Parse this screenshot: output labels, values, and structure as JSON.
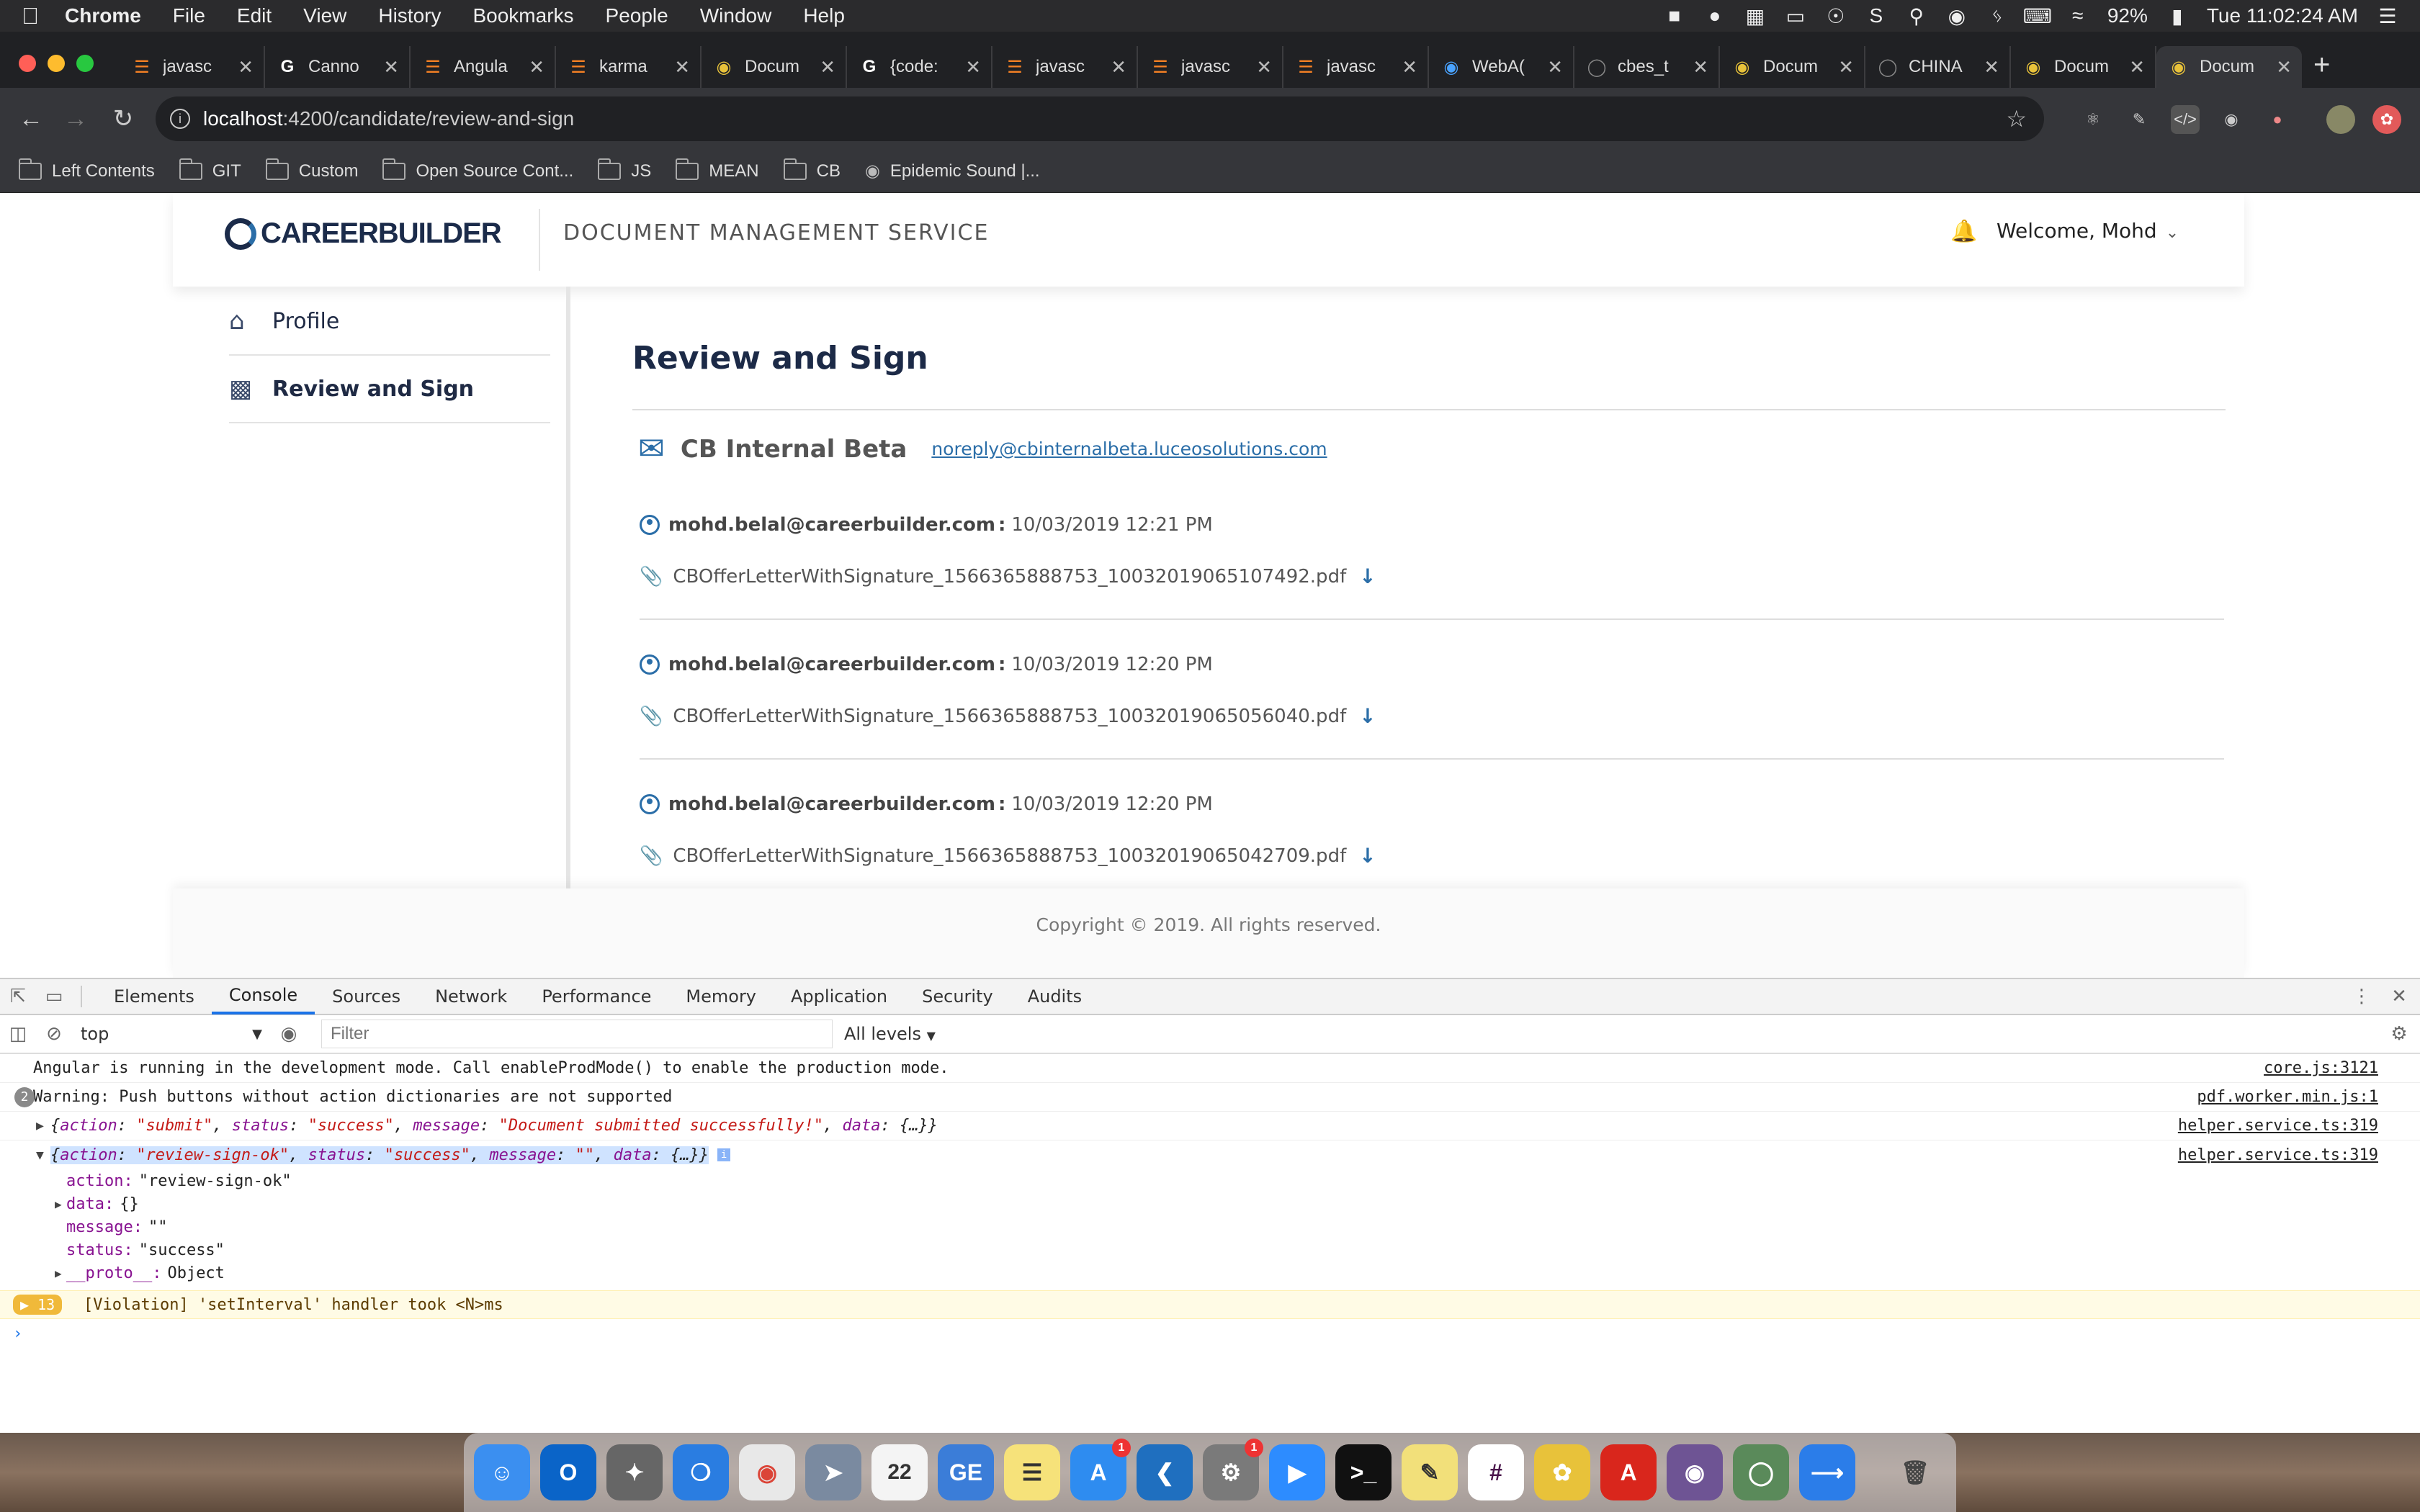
{
  "menubar": {
    "app": "Chrome",
    "items": [
      "File",
      "Edit",
      "View",
      "History",
      "Bookmarks",
      "People",
      "Window",
      "Help"
    ],
    "battery": "92%",
    "clock": "Tue 11:02:24 AM"
  },
  "tabs": [
    {
      "title": "javasc"
    },
    {
      "title": "Canno"
    },
    {
      "title": "Angula"
    },
    {
      "title": "karma"
    },
    {
      "title": "Docum"
    },
    {
      "title": "{code:"
    },
    {
      "title": "javasc"
    },
    {
      "title": "javasc"
    },
    {
      "title": "javasc"
    },
    {
      "title": "WebA("
    },
    {
      "title": "cbes_t"
    },
    {
      "title": "Docum"
    },
    {
      "title": "CHINA"
    },
    {
      "title": "Docum"
    },
    {
      "title": "Docum"
    }
  ],
  "address": {
    "host": "localhost",
    "path": ":4200/candidate/review-and-sign"
  },
  "bookmarks": [
    "Left Contents",
    "GIT",
    "Custom",
    "Open Source Cont...",
    "JS",
    "MEAN",
    "CB",
    "Epidemic Sound |..."
  ],
  "app": {
    "logo": "CAREERBUILDER",
    "service": "DOCUMENT MANAGEMENT SERVICE",
    "welcome": "Welcome, Mohd",
    "nav": [
      {
        "label": "Profile"
      },
      {
        "label": "Review and Sign"
      }
    ],
    "page_title": "Review and Sign",
    "sender_name": "CB Internal Beta",
    "sender_email": "noreply@cbinternalbeta.luceosolutions.com",
    "messages": [
      {
        "from": "mohd.belal@careerbuilder.com",
        "time": "10/03/2019 12:21 PM",
        "file": "CBOfferLetterWithSignature_1566365888753_10032019065107492.pdf"
      },
      {
        "from": "mohd.belal@careerbuilder.com",
        "time": "10/03/2019 12:20 PM",
        "file": "CBOfferLetterWithSignature_1566365888753_10032019065056040.pdf"
      },
      {
        "from": "mohd.belal@careerbuilder.com",
        "time": "10/03/2019 12:20 PM",
        "file": "CBOfferLetterWithSignature_1566365888753_10032019065042709.pdf"
      }
    ],
    "footer": "Copyright © 2019. All rights reserved."
  },
  "devtools": {
    "tabs": [
      "Elements",
      "Console",
      "Sources",
      "Network",
      "Performance",
      "Memory",
      "Application",
      "Security",
      "Audits"
    ],
    "context": "top",
    "filter_placeholder": "Filter",
    "levels": "All levels",
    "lines": {
      "l1": "Angular is running in the development mode. Call enableProdMode() to enable the production mode.",
      "l1_src": "core.js:3121",
      "l2_count": "2",
      "l2": "Warning: Push buttons without action dictionaries are not supported",
      "l2_src": "pdf.worker.min.js:1",
      "l3_src": "helper.service.ts:319",
      "l4_src": "helper.service.ts:319",
      "prop_action": "\"review-sign-ok\"",
      "prop_data": "{}",
      "prop_message": "\"\"",
      "prop_status": "\"success\"",
      "prop_proto": "Object",
      "viol_count": "13",
      "viol": "[Violation] 'setInterval' handler took <N>ms"
    }
  }
}
